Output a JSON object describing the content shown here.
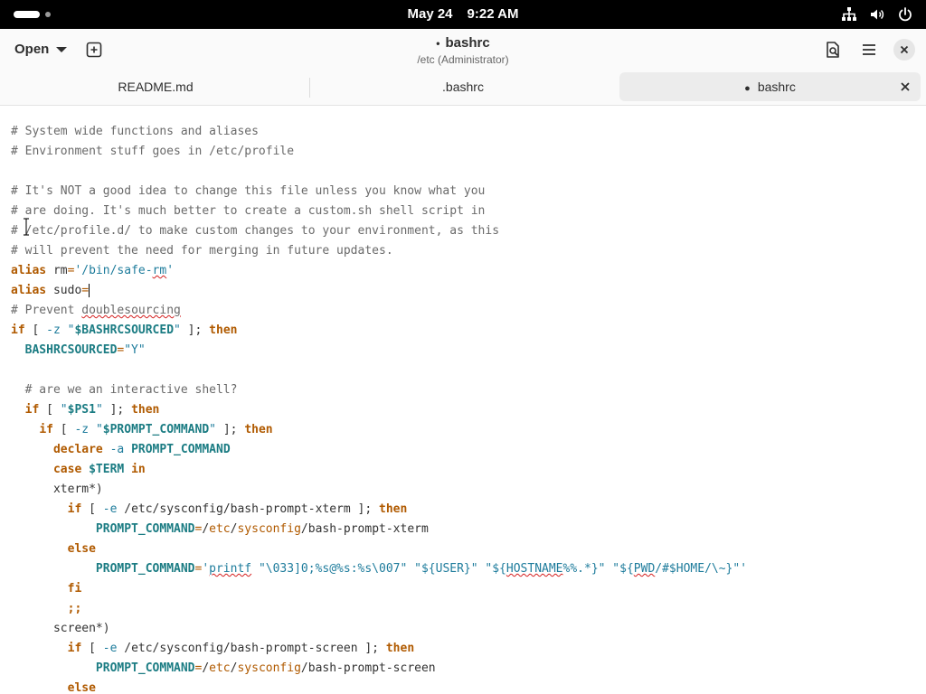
{
  "system": {
    "date": "May 24",
    "time": "9:22 AM",
    "icons": [
      "network-icon",
      "volume-icon",
      "power-icon"
    ]
  },
  "header": {
    "open_label": "Open",
    "title": "bashrc",
    "modified_dot": "•",
    "subtitle": "/etc (Administrator)"
  },
  "tabs": [
    {
      "label": "README.md"
    },
    {
      "label": ".bashrc"
    },
    {
      "label": "bashrc",
      "modified_dot": "●"
    }
  ],
  "code": [
    {
      "segs": [
        {
          "t": "# System wide functions and aliases",
          "c": "c"
        }
      ]
    },
    {
      "segs": [
        {
          "t": "# Environment stuff goes in /etc/profile",
          "c": "c"
        }
      ]
    },
    {
      "segs": []
    },
    {
      "segs": [
        {
          "t": "# It's NOT a good idea to change this file unless you know what you",
          "c": "c"
        }
      ]
    },
    {
      "segs": [
        {
          "t": "# are doing. It's much better to create a custom.sh shell script in",
          "c": "c"
        }
      ]
    },
    {
      "segs": [
        {
          "t": "# /etc/profile.d/ to make custom changes to your environment, as this",
          "c": "c"
        }
      ]
    },
    {
      "segs": [
        {
          "t": "# will prevent the need for merging in future updates.",
          "c": "c"
        }
      ]
    },
    {
      "segs": [
        {
          "t": "alias",
          "c": "k"
        },
        {
          "t": " rm"
        },
        {
          "t": "=",
          "c": "o"
        },
        {
          "t": "'/bin/safe-",
          "c": "s"
        },
        {
          "t": "rm",
          "c": "s sp"
        },
        {
          "t": "'",
          "c": "s"
        }
      ]
    },
    {
      "segs": [
        {
          "t": "alias",
          "c": "k"
        },
        {
          "t": " sudo"
        },
        {
          "t": "=",
          "c": "o"
        }
      ],
      "cursor": true
    },
    {
      "segs": [
        {
          "t": "# Prevent ",
          "c": "c"
        },
        {
          "t": "doublesourcing",
          "c": "c sp"
        }
      ]
    },
    {
      "segs": [
        {
          "t": "if",
          "c": "k"
        },
        {
          "t": " [ "
        },
        {
          "t": "-z",
          "c": "s"
        },
        {
          "t": " "
        },
        {
          "t": "\"",
          "c": "s"
        },
        {
          "t": "$BASHRCSOURCED",
          "c": "v"
        },
        {
          "t": "\"",
          "c": "s"
        },
        {
          "t": " ]; "
        },
        {
          "t": "then",
          "c": "k"
        }
      ]
    },
    {
      "segs": [
        {
          "t": "  "
        },
        {
          "t": "BASHRCSOURCED",
          "c": "v"
        },
        {
          "t": "=",
          "c": "o"
        },
        {
          "t": "\"Y\"",
          "c": "s"
        }
      ]
    },
    {
      "segs": []
    },
    {
      "segs": [
        {
          "t": "  # are we an interactive shell?",
          "c": "c"
        }
      ]
    },
    {
      "segs": [
        {
          "t": "  "
        },
        {
          "t": "if",
          "c": "k"
        },
        {
          "t": " [ "
        },
        {
          "t": "\"",
          "c": "s"
        },
        {
          "t": "$PS1",
          "c": "v"
        },
        {
          "t": "\"",
          "c": "s"
        },
        {
          "t": " ]; "
        },
        {
          "t": "then",
          "c": "k"
        }
      ]
    },
    {
      "segs": [
        {
          "t": "    "
        },
        {
          "t": "if",
          "c": "k"
        },
        {
          "t": " [ "
        },
        {
          "t": "-z",
          "c": "s"
        },
        {
          "t": " "
        },
        {
          "t": "\"",
          "c": "s"
        },
        {
          "t": "$PROMPT_COMMAND",
          "c": "v"
        },
        {
          "t": "\"",
          "c": "s"
        },
        {
          "t": " ]; "
        },
        {
          "t": "then",
          "c": "k"
        }
      ]
    },
    {
      "segs": [
        {
          "t": "      "
        },
        {
          "t": "declare",
          "c": "k"
        },
        {
          "t": " "
        },
        {
          "t": "-a",
          "c": "s"
        },
        {
          "t": " "
        },
        {
          "t": "PROMPT_COMMAND",
          "c": "v"
        }
      ]
    },
    {
      "segs": [
        {
          "t": "      "
        },
        {
          "t": "case",
          "c": "k"
        },
        {
          "t": " "
        },
        {
          "t": "$TERM",
          "c": "v"
        },
        {
          "t": " "
        },
        {
          "t": "in",
          "c": "k"
        }
      ]
    },
    {
      "segs": [
        {
          "t": "      xterm*)"
        }
      ]
    },
    {
      "segs": [
        {
          "t": "        "
        },
        {
          "t": "if",
          "c": "k"
        },
        {
          "t": " [ "
        },
        {
          "t": "-e",
          "c": "s"
        },
        {
          "t": " /etc/sysconfig/bash-prompt-xterm ]; "
        },
        {
          "t": "then",
          "c": "k"
        }
      ]
    },
    {
      "segs": [
        {
          "t": "            "
        },
        {
          "t": "PROMPT_COMMAND",
          "c": "v"
        },
        {
          "t": "=",
          "c": "o"
        },
        {
          "t": "/"
        },
        {
          "t": "etc",
          "c": "o"
        },
        {
          "t": "/"
        },
        {
          "t": "sysconfig",
          "c": "o"
        },
        {
          "t": "/"
        },
        {
          "t": "bash-prompt-xterm"
        }
      ]
    },
    {
      "segs": [
        {
          "t": "        "
        },
        {
          "t": "else",
          "c": "k"
        }
      ]
    },
    {
      "segs": [
        {
          "t": "            "
        },
        {
          "t": "PROMPT_COMMAND",
          "c": "v"
        },
        {
          "t": "=",
          "c": "o"
        },
        {
          "t": "'",
          "c": "s"
        },
        {
          "t": "printf",
          "c": "s sp"
        },
        {
          "t": " \"\\033]0;%s@%s:%s\\007\" \"${USER}\" \"${",
          "c": "s"
        },
        {
          "t": "HOSTNAME",
          "c": "s sp"
        },
        {
          "t": "%%.*}\" \"${",
          "c": "s"
        },
        {
          "t": "PWD",
          "c": "s sp"
        },
        {
          "t": "/#$HOME/\\~}\"'",
          "c": "s"
        }
      ]
    },
    {
      "segs": [
        {
          "t": "        "
        },
        {
          "t": "fi",
          "c": "k"
        }
      ]
    },
    {
      "segs": [
        {
          "t": "        "
        },
        {
          "t": ";;",
          "c": "k"
        }
      ]
    },
    {
      "segs": [
        {
          "t": "      screen*)"
        }
      ]
    },
    {
      "segs": [
        {
          "t": "        "
        },
        {
          "t": "if",
          "c": "k"
        },
        {
          "t": " [ "
        },
        {
          "t": "-e",
          "c": "s"
        },
        {
          "t": " /etc/sysconfig/bash-prompt-screen ]; "
        },
        {
          "t": "then",
          "c": "k"
        }
      ]
    },
    {
      "segs": [
        {
          "t": "            "
        },
        {
          "t": "PROMPT_COMMAND",
          "c": "v"
        },
        {
          "t": "=",
          "c": "o"
        },
        {
          "t": "/"
        },
        {
          "t": "etc",
          "c": "o"
        },
        {
          "t": "/"
        },
        {
          "t": "sysconfig",
          "c": "o"
        },
        {
          "t": "/"
        },
        {
          "t": "bash-prompt-screen"
        }
      ]
    },
    {
      "segs": [
        {
          "t": "        "
        },
        {
          "t": "else",
          "c": "k"
        }
      ]
    }
  ]
}
